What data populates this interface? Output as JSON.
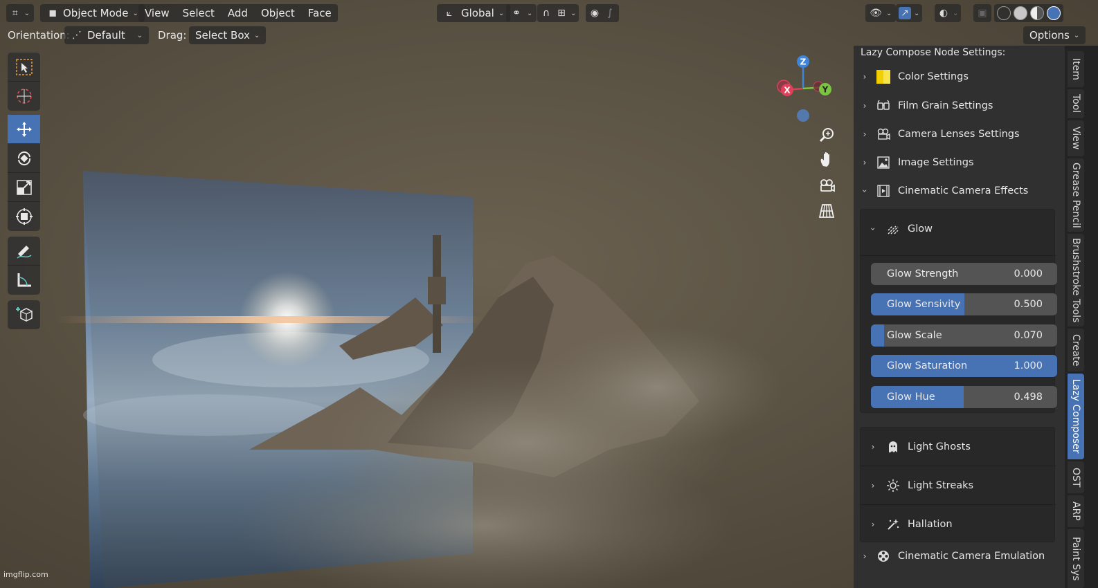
{
  "header": {
    "editor_icon": "grid-editor-icon",
    "mode_label": "Object Mode",
    "menus": [
      "View",
      "Select",
      "Add",
      "Object",
      "Face"
    ],
    "transform_orientation": "Global",
    "options_label": "Options"
  },
  "tool_settings": {
    "orientation_label": "Orientation:",
    "orientation_value": "Default",
    "drag_label": "Drag:",
    "drag_value": "Select Box"
  },
  "toolbar": {
    "tools": [
      "select-box",
      "cursor",
      "move",
      "rotate",
      "scale",
      "transform",
      "annotate",
      "measure",
      "add-cube"
    ],
    "active": "move"
  },
  "gizmo": {
    "x": "X",
    "y": "Y",
    "z": "Z"
  },
  "panel": {
    "title": "Lazy Compose Node Settings:",
    "sections": [
      {
        "label": "Color Settings",
        "icon": "color-swatch-icon",
        "expanded": false
      },
      {
        "label": "Film Grain Settings",
        "icon": "glasses-icon",
        "expanded": false
      },
      {
        "label": "Camera Lenses Settings",
        "icon": "camera-icon",
        "expanded": false
      },
      {
        "label": "Image Settings",
        "icon": "image-icon",
        "expanded": false
      },
      {
        "label": "Cinematic Camera Effects",
        "icon": "film-icon",
        "expanded": true
      }
    ],
    "glow": {
      "label": "Glow",
      "sliders": [
        {
          "name": "Glow Strength",
          "value": "0.000",
          "fraction": 0.0
        },
        {
          "name": "Glow Sensivity",
          "value": "0.500",
          "fraction": 0.5
        },
        {
          "name": "Glow Scale",
          "value": "0.070",
          "fraction": 0.07
        },
        {
          "name": "Glow Saturation",
          "value": "1.000",
          "fraction": 1.0
        },
        {
          "name": "Glow Hue",
          "value": "0.498",
          "fraction": 0.498
        }
      ]
    },
    "subsections": [
      {
        "label": "Light Ghosts",
        "icon": "ghost-icon"
      },
      {
        "label": "Light Streaks",
        "icon": "sun-icon"
      },
      {
        "label": "Hallation",
        "icon": "sparkle-icon"
      }
    ],
    "last_section": {
      "label": "Cinematic Camera Emulation",
      "icon": "film-reel-icon"
    }
  },
  "tabs": [
    "Item",
    "Tool",
    "View",
    "Grease Pencil",
    "Brushstroke Tools",
    "Create",
    "Lazy Composer",
    "OST",
    "ARP",
    "Paint Sys"
  ],
  "active_tab": "Lazy Composer",
  "watermark": "imgflip.com"
}
